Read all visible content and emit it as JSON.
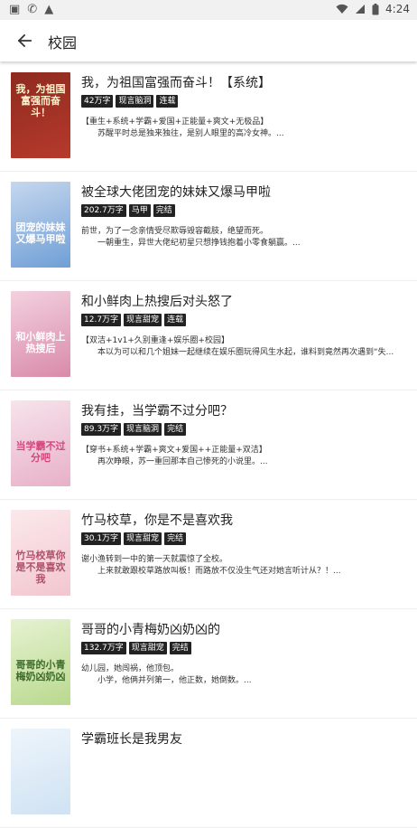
{
  "app": {
    "title": "校园"
  },
  "status": {
    "time": "4:24"
  },
  "books": [
    {
      "title": "我，为祖国富强而奋斗！【系统】",
      "tags": [
        "42万字",
        "现言脑洞",
        "连载"
      ],
      "desc1": "【重生+系统+学霸+爱国+正能量+爽文+无极品】",
      "desc2": "苏醒平时总是独来独往，是别人眼里的高冷女神。...",
      "cover": {
        "bg": "#b63a2c",
        "bg2": "#8e2a1f",
        "text": "我，为祖国富强而奋斗！",
        "text_color": "#fff6d0"
      }
    },
    {
      "title": "被全球大佬团宠的妹妹又爆马甲啦",
      "tags": [
        "202.7万字",
        "马甲",
        "完结"
      ],
      "desc1": "前世，为了一念亲情受尽欺辱毁容截肢，绝望而死。",
      "desc2": "一朝重生，异世大佬纪初星只想挣钱抱着小零食躺赢。...",
      "cover": {
        "bg": "#6f9fd6",
        "bg2": "#c6d7ee",
        "text": "团宠的妹妹又爆马甲啦",
        "text_color": "#ffffff"
      }
    },
    {
      "title": "和小鲜肉上热搜后对头怒了",
      "tags": [
        "12.7万字",
        "现言甜宠",
        "连载"
      ],
      "desc1": "【双洁+1v1+久别重逢+娱乐圈+校园】",
      "desc2": "本以为可以和几个姐妹一起继续在娱乐圈玩得风生水起，谁料到竟然再次遇到“失...",
      "cover": {
        "bg": "#d98aa9",
        "bg2": "#f3d1df",
        "text": "和小鲜肉上热搜后",
        "text_color": "#ffffff"
      }
    },
    {
      "title": "我有挂，当学霸不过分吧？",
      "tags": [
        "89.3万字",
        "现言脑洞",
        "完结"
      ],
      "desc1": "【穿书+系统+学霸+爽文+爱国++正能量+双洁】",
      "desc2": "再次睁眼，苏一重回那本自己惨死的小说里。...",
      "cover": {
        "bg": "#e8b0c8",
        "bg2": "#f6e4ec",
        "text": "当学霸不过分吧",
        "text_color": "#d2497f"
      }
    },
    {
      "title": "竹马校草，你是不是喜欢我",
      "tags": [
        "30.1万字",
        "现言甜宠",
        "完结"
      ],
      "desc1": "谢小渔转到一中的第一天就震惊了全校。",
      "desc2": "上来就敢跟校草路放叫板！而路放不仅没生气还对她言听计从？！...",
      "cover": {
        "bg": "#f2c6cf",
        "bg2": "#fbe9ec",
        "text": "竹马校草你是不是喜欢我",
        "text_color": "#b0506a"
      }
    },
    {
      "title": "哥哥的小青梅奶凶奶凶的",
      "tags": [
        "132.7万字",
        "现言甜宠",
        "完结"
      ],
      "desc1": "幼儿园，她闯祸，他顶包。",
      "desc2": "小学，他俩并列第一，他正数，她倒数。...",
      "cover": {
        "bg": "#b9d98d",
        "bg2": "#e6f2d2",
        "text": "哥哥的小青梅奶凶奶凶",
        "text_color": "#3d6a2a"
      }
    },
    {
      "title": "学霸班长是我男友",
      "tags": [],
      "desc1": "",
      "desc2": "",
      "cover": {
        "bg": "#cfe2f3",
        "bg2": "#eef5fb",
        "text": "",
        "text_color": "#2b5f8f"
      }
    }
  ]
}
